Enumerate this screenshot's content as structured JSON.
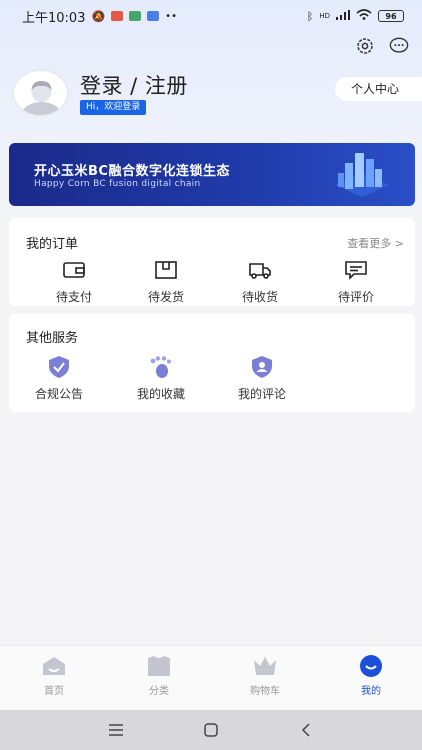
{
  "status_bar": {
    "time": "上午10:03",
    "battery": "96",
    "network": "HD"
  },
  "header": {
    "settings_icon": "gear-icon",
    "message_icon": "chat-bubble-icon"
  },
  "profile": {
    "title": "登录 / 注册",
    "welcome": "Hi，欢迎登录",
    "personal_center": "个人中心"
  },
  "banner": {
    "title": "开心玉米BC融合数字化连锁生态",
    "subtitle": "Happy Corn BC fusion digital chain"
  },
  "orders": {
    "title": "我的订单",
    "see_more": "查看更多 >",
    "items": [
      {
        "label": "待支付",
        "icon": "wallet-icon"
      },
      {
        "label": "待发货",
        "icon": "package-icon"
      },
      {
        "label": "待收货",
        "icon": "truck-icon"
      },
      {
        "label": "待评价",
        "icon": "comment-icon"
      }
    ]
  },
  "services": {
    "title": "其他服务",
    "items": [
      {
        "label": "合规公告",
        "icon": "shield-check-icon"
      },
      {
        "label": "我的收藏",
        "icon": "footprint-icon"
      },
      {
        "label": "我的评论",
        "icon": "user-shield-icon"
      }
    ]
  },
  "tabs": [
    {
      "label": "首页",
      "icon": "home-icon"
    },
    {
      "label": "分类",
      "icon": "bag-icon"
    },
    {
      "label": "购物车",
      "icon": "crown-icon"
    },
    {
      "label": "我的",
      "icon": "smile-icon",
      "active": true
    }
  ],
  "colors": {
    "accent": "#1d4fd8",
    "banner": "#1f3aa8",
    "icon_purple": "#7b7fd6"
  }
}
